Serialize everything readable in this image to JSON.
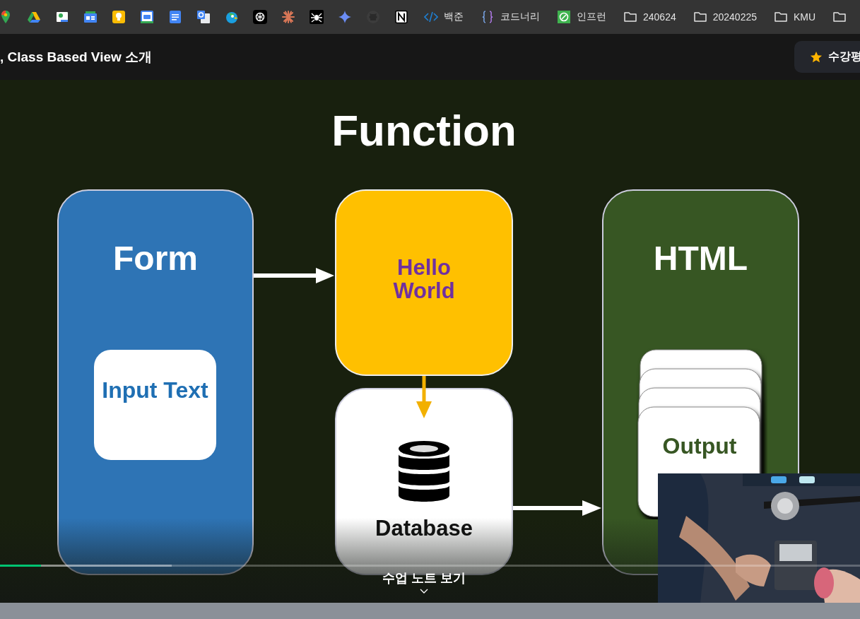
{
  "bookmarks_bar": {
    "items": [
      {
        "kind": "code",
        "label": "백준"
      },
      {
        "kind": "braces",
        "label": "코드너리"
      },
      {
        "kind": "inflearn",
        "label": "인프런"
      },
      {
        "kind": "folder",
        "label": "240624"
      },
      {
        "kind": "folder",
        "label": "20240225"
      },
      {
        "kind": "folder",
        "label": "KMU"
      },
      {
        "kind": "folder"
      }
    ]
  },
  "header": {
    "title": ", Class Based View 소개",
    "review_button": "수강평"
  },
  "slide": {
    "title": "Function",
    "form": {
      "title": "Form",
      "card": "Input Text"
    },
    "function": {
      "title": "Hello World"
    },
    "database": {
      "title": "Database"
    },
    "html": {
      "title": "HTML",
      "card": "Output"
    }
  },
  "player": {
    "progress": {
      "level": 0.048
    },
    "buffer": {
      "level": 0.2
    },
    "notes_toggle": "수업 노트 보기"
  }
}
